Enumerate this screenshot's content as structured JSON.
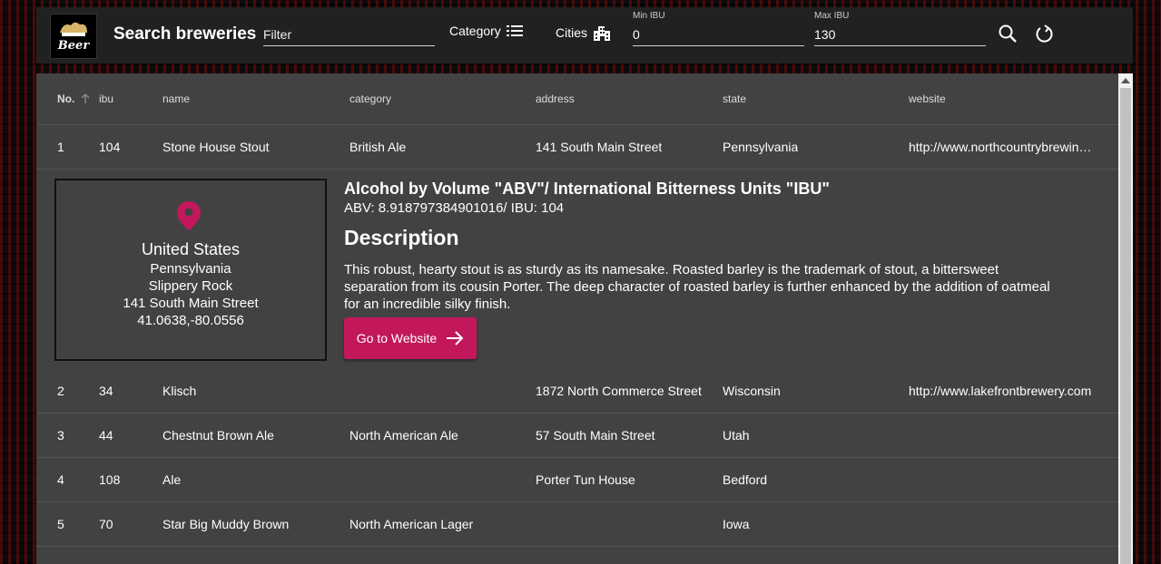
{
  "toolbar": {
    "logo_text": "Beer",
    "title": "Search breweries",
    "filter_placeholder": "Filter",
    "category_label": "Category",
    "cities_label": "Cities",
    "min_ibu_label": "Min IBU",
    "min_ibu_value": "0",
    "max_ibu_label": "Max IBU",
    "max_ibu_value": "130",
    "icons": [
      "list-icon",
      "city-icon",
      "search-icon",
      "reset-icon"
    ]
  },
  "table": {
    "headers": [
      "No.",
      "ibu",
      "name",
      "category",
      "address",
      "state",
      "website"
    ],
    "sort_icon": "arrow-up-icon",
    "rows": [
      [
        "1",
        "104",
        "Stone House Stout",
        "British Ale",
        "141 South Main Street",
        "Pennsylvania",
        "http://www.northcountrybrewing.com"
      ],
      [
        "2",
        "34",
        "Klisch",
        "",
        "1872 North Commerce Street",
        "Wisconsin",
        "http://www.lakefrontbrewery.com"
      ],
      [
        "3",
        "44",
        "Chestnut Brown Ale",
        "North American Ale",
        "57 South Main Street",
        "Utah",
        ""
      ],
      [
        "4",
        "108",
        "Ale",
        "",
        "Porter Tun House",
        "Bedford",
        ""
      ],
      [
        "5",
        "70",
        "Star Big Muddy Brown",
        "North American Lager",
        "",
        "Iowa",
        ""
      ]
    ]
  },
  "detail": {
    "country": "United States",
    "state": "Pennsylvania",
    "city": "Slippery Rock",
    "address": "141 South Main Street",
    "coords": "41.0638,-80.0556",
    "abv_title": "Alcohol by Volume \"ABV\"/ International Bitterness Units \"IBU\"",
    "abv_value": "ABV: 8.918797384901016/ IBU: 104",
    "desc_title": "Description",
    "desc_text": "This robust, hearty stout is as sturdy as its namesake. Roasted barley is the trademark of stout, a bittersweet separation from its cousin Porter. The deep character of roasted barley is further enhanced by the addition of oatmeal for an incredible silky finish.",
    "button_label": "Go to Website"
  },
  "colors": {
    "accent": "#c2185b",
    "toolbar_bg": "#212121",
    "panel_bg": "#424242"
  }
}
